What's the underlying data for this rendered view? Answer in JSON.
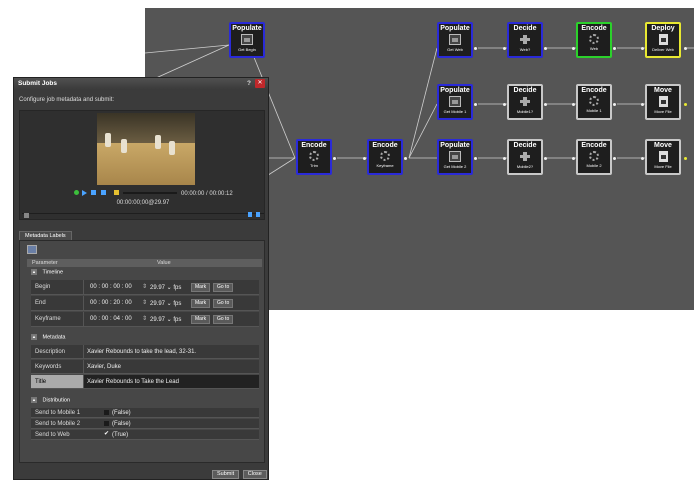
{
  "workflow": {
    "nodes": [
      {
        "id": "pop-begin",
        "title": "Populate",
        "sub": "Get Begin",
        "icon": "document-icon"
      },
      {
        "id": "enc-trim",
        "title": "Encode",
        "sub": "Trim",
        "icon": "gear-icon"
      },
      {
        "id": "enc-keyframe",
        "title": "Encode",
        "sub": "Keyframe",
        "icon": "gear-icon"
      },
      {
        "id": "pop-web",
        "title": "Populate",
        "sub": "Get Web",
        "icon": "document-icon"
      },
      {
        "id": "pop-mobile1",
        "title": "Populate",
        "sub": "Get Mobile 1",
        "icon": "document-icon"
      },
      {
        "id": "pop-mobile2",
        "title": "Populate",
        "sub": "Get Mobile 2",
        "icon": "document-icon"
      },
      {
        "id": "dec-web",
        "title": "Decide",
        "sub": "Web?",
        "icon": "fork-icon"
      },
      {
        "id": "dec-mobile1",
        "title": "Decide",
        "sub": "Mobile1?",
        "icon": "fork-icon"
      },
      {
        "id": "dec-mobile2",
        "title": "Decide",
        "sub": "Mobile2?",
        "icon": "fork-icon"
      },
      {
        "id": "enc-web",
        "title": "Encode",
        "sub": "Web",
        "icon": "gear-icon"
      },
      {
        "id": "enc-mobile1",
        "title": "Encode",
        "sub": "Mobile 1",
        "icon": "gear-icon"
      },
      {
        "id": "enc-mobile2",
        "title": "Encode",
        "sub": "Mobile 2",
        "icon": "gear-icon"
      },
      {
        "id": "deploy-web",
        "title": "Deploy",
        "sub": "Deliver Web",
        "icon": "file-icon"
      },
      {
        "id": "move-1",
        "title": "Move",
        "sub": "Move File",
        "icon": "file-icon"
      },
      {
        "id": "move-2",
        "title": "Move",
        "sub": "Move File",
        "icon": "file-icon"
      }
    ]
  },
  "dialog": {
    "title": "Submit Jobs",
    "help": "?",
    "close": "✕",
    "subtitle": "Configure job metadata and submit:",
    "player": {
      "time": "00:00:00 / 00:00:12",
      "timecode": "00:00:00;00@29.97"
    },
    "tab": "Metadata Labels",
    "grid_header": {
      "param": "Parameter",
      "value": "Value"
    },
    "timeline_section": "Timeline",
    "timeline_rows": [
      {
        "label": "Begin",
        "value": "00 : 00 : 00 : 00",
        "fps": "29.97",
        "unit": "fps",
        "mark": "Mark",
        "goto": "Go to"
      },
      {
        "label": "End",
        "value": "00 : 00 : 20 : 00",
        "fps": "29.97",
        "unit": "fps",
        "mark": "Mark",
        "goto": "Go to"
      },
      {
        "label": "Keyframe",
        "value": "00 : 00 : 04 : 00",
        "fps": "29.97",
        "unit": "fps",
        "mark": "Mark",
        "goto": "Go to"
      }
    ],
    "metadata_section": "Metadata",
    "metadata_rows": [
      {
        "label": "Description",
        "value": "Xavier Rebounds to take the lead, 32-31."
      },
      {
        "label": "Keywords",
        "value": "Xavier, Duke"
      },
      {
        "label": "Title",
        "value": "Xavier Rebounds to Take the Lead"
      }
    ],
    "distribution_section": "Distribution",
    "distribution_rows": [
      {
        "label": "Send to Mobile 1",
        "value": "(False)",
        "checked": false
      },
      {
        "label": "Send to Mobile 2",
        "value": "(False)",
        "checked": false
      },
      {
        "label": "Send to Web",
        "value": "(True)",
        "checked": true
      }
    ],
    "submit": "Submit",
    "close_btn": "Close"
  }
}
